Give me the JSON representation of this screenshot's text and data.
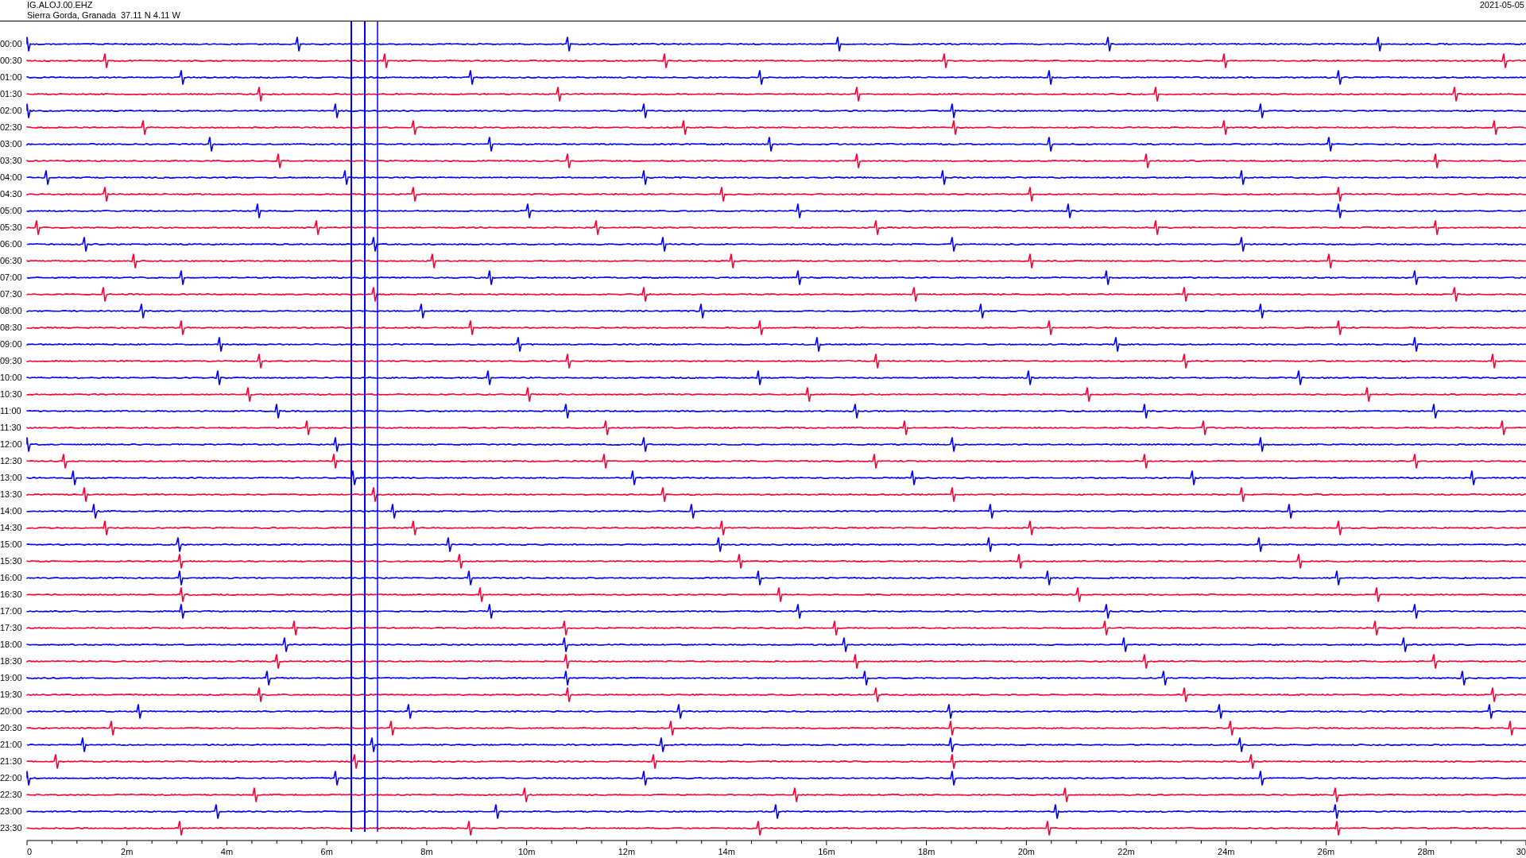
{
  "header": {
    "station": "IG.ALOJ.00.EHZ",
    "location": "Sierra Gorda, Granada  37.11 N 4.11 W",
    "date": "2021-05-05"
  },
  "rows": [
    {
      "label": "00:00",
      "color": "#0000ff"
    },
    {
      "label": "00:30",
      "color": "#ff0033"
    },
    {
      "label": "01:00",
      "color": "#0000ff"
    },
    {
      "label": "01:30",
      "color": "#ff0033"
    },
    {
      "label": "02:00",
      "color": "#0000ff"
    },
    {
      "label": "02:30",
      "color": "#ff0033"
    },
    {
      "label": "03:00",
      "color": "#0000ff"
    },
    {
      "label": "03:30",
      "color": "#ff0033"
    },
    {
      "label": "04:00",
      "color": "#0000ff"
    },
    {
      "label": "04:30",
      "color": "#ff0033"
    },
    {
      "label": "05:00",
      "color": "#0000ff"
    },
    {
      "label": "05:30",
      "color": "#ff0033"
    },
    {
      "label": "06:00",
      "color": "#0000ff"
    },
    {
      "label": "06:30",
      "color": "#ff0033"
    },
    {
      "label": "07:00",
      "color": "#0000ff"
    },
    {
      "label": "07:30",
      "color": "#ff0033"
    },
    {
      "label": "08:00",
      "color": "#0000ff"
    },
    {
      "label": "08:30",
      "color": "#ff0033"
    },
    {
      "label": "09:00",
      "color": "#0000ff"
    },
    {
      "label": "09:30",
      "color": "#ff0033"
    },
    {
      "label": "10:00",
      "color": "#0000ff"
    },
    {
      "label": "10:30",
      "color": "#ff0033"
    },
    {
      "label": "11:00",
      "color": "#0000ff"
    },
    {
      "label": "11:30",
      "color": "#ff0033"
    },
    {
      "label": "12:00",
      "color": "#0000ff"
    },
    {
      "label": "12:30",
      "color": "#ff0033"
    },
    {
      "label": "13:00",
      "color": "#0000ff"
    },
    {
      "label": "13:30",
      "color": "#ff0033"
    },
    {
      "label": "14:00",
      "color": "#0000ff"
    },
    {
      "label": "14:30",
      "color": "#ff0033"
    },
    {
      "label": "15:00",
      "color": "#0000ff"
    },
    {
      "label": "15:30",
      "color": "#ff0033"
    },
    {
      "label": "16:00",
      "color": "#0000ff"
    },
    {
      "label": "16:30",
      "color": "#ff0033"
    },
    {
      "label": "17:00",
      "color": "#0000ff"
    },
    {
      "label": "17:30",
      "color": "#ff0033"
    },
    {
      "label": "18:00",
      "color": "#0000ff"
    },
    {
      "label": "18:30",
      "color": "#ff0033"
    },
    {
      "label": "19:00",
      "color": "#0000ff"
    },
    {
      "label": "19:30",
      "color": "#ff0033"
    },
    {
      "label": "20:00",
      "color": "#0000ff"
    },
    {
      "label": "20:30",
      "color": "#ff0033"
    },
    {
      "label": "21:00",
      "color": "#0000ff"
    },
    {
      "label": "21:30",
      "color": "#ff0033"
    },
    {
      "label": "22:00",
      "color": "#0000ff"
    },
    {
      "label": "22:30",
      "color": "#ff0033"
    },
    {
      "label": "23:00",
      "color": "#0000ff"
    },
    {
      "label": "23:30",
      "color": "#ff0033"
    }
  ],
  "x_axis": {
    "ticks": [
      "0",
      "2m",
      "4m",
      "6m",
      "8m",
      "10m",
      "12m",
      "14m",
      "16m",
      "18m",
      "20m",
      "22m",
      "24m",
      "26m",
      "28m",
      "30"
    ]
  }
}
